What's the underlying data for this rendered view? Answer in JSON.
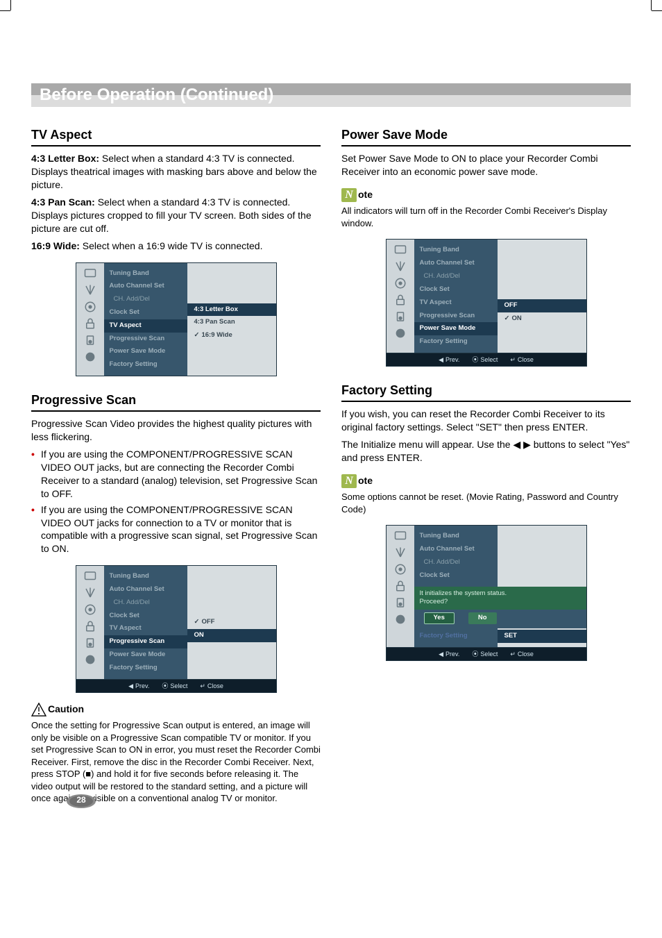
{
  "page": {
    "number": "28",
    "title": "Before Operation (Continued)"
  },
  "left": {
    "tv_aspect": {
      "heading": "TV Aspect",
      "p1_label": "4:3 Letter Box:",
      "p1_text": " Select when a standard 4:3 TV is connected. Displays theatrical images with masking bars above and below the picture.",
      "p2_label": "4:3 Pan Scan:",
      "p2_text": " Select when a standard 4:3 TV is connected. Displays pictures cropped to fill your TV screen. Both sides of the picture are cut off.",
      "p3_label": "16:9 Wide:",
      "p3_text": " Select when a 16:9 wide TV is connected."
    },
    "progressive": {
      "heading": "Progressive Scan",
      "intro": "Progressive Scan Video provides the highest quality pictures with less flickering.",
      "b1": "If you are using the COMPONENT/PROGRESSIVE SCAN VIDEO OUT jacks, but are connecting the Recorder Combi Receiver to a standard (analog) television, set Progressive Scan to OFF.",
      "b2": "If you are using the COMPONENT/PROGRESSIVE SCAN VIDEO OUT jacks for connection to a TV or monitor that is compatible with a progressive scan signal, set Progressive Scan to ON."
    },
    "caution": {
      "label": "Caution",
      "text": "Once the setting for Progressive Scan output is entered, an image will only be visible on a Progressive Scan compatible TV or monitor. If you set Progressive Scan to ON in error, you must reset the Recorder Combi Receiver. First, remove the disc in the Recorder Combi Receiver. Next, press STOP (■) and hold it for five seconds before releasing it. The video output will be restored to the standard setting, and a picture will once again be visible on a conventional analog TV or monitor."
    }
  },
  "right": {
    "psm": {
      "heading": "Power Save Mode",
      "text": "Set Power Save Mode to ON to place your Recorder Combi Receiver into an economic power save mode.",
      "note_label": "ote",
      "note_text": "All indicators will turn off in the Recorder Combi Receiver's Display window."
    },
    "factory": {
      "heading": "Factory Setting",
      "p1": "If you wish, you can reset the Recorder Combi Receiver to its original factory settings. Select \"SET\" then press ENTER.",
      "p2": "The Initialize menu will appear. Use the ◀ ▶ buttons to select \"Yes\" and press ENTER.",
      "note_label": "ote",
      "note_text": "Some options cannot be reset. (Movie Rating, Password and Country Code)"
    }
  },
  "osd_common": {
    "tuning": "Tuning Band",
    "auto": "Auto Channel Set",
    "ch": "CH. Add/Del",
    "clock": "Clock Set",
    "tvaspect": "TV Aspect",
    "prog": "Progressive Scan",
    "psm": "Power Save Mode",
    "factory": "Factory Setting",
    "foot_prev": "Prev.",
    "foot_select": "Select",
    "foot_close": "Close"
  },
  "osd1_vals": {
    "a": "4:3 Letter Box",
    "b": "4:3 Pan Scan",
    "c": "16:9 Wide"
  },
  "osd2_vals": {
    "a": "OFF",
    "b": "ON"
  },
  "osd3_vals": {
    "a": "OFF",
    "b": "ON"
  },
  "osd4": {
    "prompt1": "It initializes the system status.",
    "prompt2": "Proceed?",
    "yes": "Yes",
    "no": "No",
    "set": "SET"
  },
  "note_glyph": "N"
}
